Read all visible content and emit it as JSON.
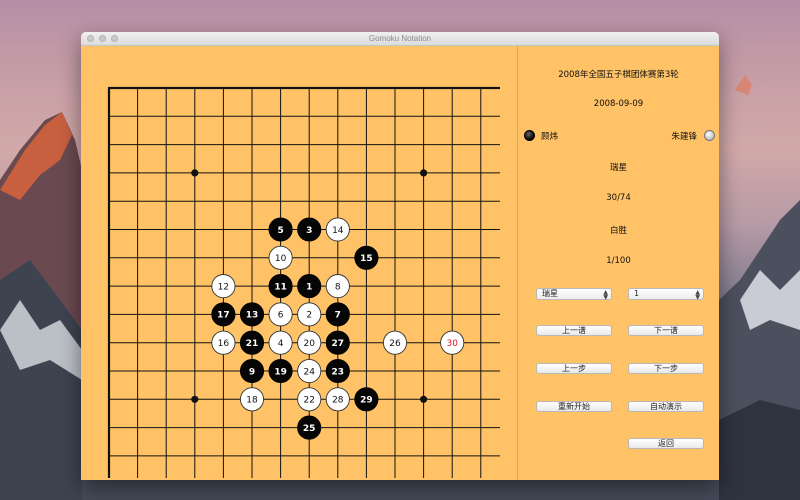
{
  "window": {
    "title": "Gomoku Notation"
  },
  "game": {
    "event": "2008年全国五子棋团体赛第3轮",
    "date": "2008-09-09",
    "black_player": "顾炜",
    "white_player": "朱建锋",
    "opening": "瑞星",
    "move_progress": "30/74",
    "result": "白胜",
    "record_index": "1/100"
  },
  "controls": {
    "opening_select": "瑞星",
    "record_select": "1",
    "prev_record": "上一谱",
    "next_record": "下一谱",
    "prev_step": "上一步",
    "next_step": "下一步",
    "restart": "重新开始",
    "autoplay": "自动演示",
    "back": "返回"
  },
  "board": {
    "size": 15,
    "star_points": [
      [
        3,
        3
      ],
      [
        11,
        3
      ],
      [
        3,
        11
      ],
      [
        11,
        11
      ]
    ],
    "last_move_color": "#e0102a",
    "stones": [
      {
        "n": 1,
        "col": 7,
        "row": 7,
        "color": "black"
      },
      {
        "n": 2,
        "col": 7,
        "row": 8,
        "color": "white"
      },
      {
        "n": 3,
        "col": 7,
        "row": 5,
        "color": "black"
      },
      {
        "n": 4,
        "col": 6,
        "row": 9,
        "color": "white"
      },
      {
        "n": 5,
        "col": 6,
        "row": 5,
        "color": "black"
      },
      {
        "n": 6,
        "col": 6,
        "row": 8,
        "color": "white"
      },
      {
        "n": 7,
        "col": 8,
        "row": 8,
        "color": "black"
      },
      {
        "n": 8,
        "col": 8,
        "row": 7,
        "color": "white"
      },
      {
        "n": 9,
        "col": 5,
        "row": 10,
        "color": "black"
      },
      {
        "n": 10,
        "col": 6,
        "row": 6,
        "color": "white"
      },
      {
        "n": 11,
        "col": 6,
        "row": 7,
        "color": "black"
      },
      {
        "n": 12,
        "col": 4,
        "row": 7,
        "color": "white"
      },
      {
        "n": 13,
        "col": 5,
        "row": 8,
        "color": "black"
      },
      {
        "n": 14,
        "col": 8,
        "row": 5,
        "color": "white"
      },
      {
        "n": 15,
        "col": 9,
        "row": 6,
        "color": "black"
      },
      {
        "n": 16,
        "col": 4,
        "row": 9,
        "color": "white"
      },
      {
        "n": 17,
        "col": 4,
        "row": 8,
        "color": "black"
      },
      {
        "n": 18,
        "col": 5,
        "row": 11,
        "color": "white"
      },
      {
        "n": 19,
        "col": 6,
        "row": 10,
        "color": "black"
      },
      {
        "n": 20,
        "col": 7,
        "row": 9,
        "color": "white"
      },
      {
        "n": 21,
        "col": 5,
        "row": 9,
        "color": "black"
      },
      {
        "n": 22,
        "col": 7,
        "row": 11,
        "color": "white"
      },
      {
        "n": 23,
        "col": 8,
        "row": 10,
        "color": "black"
      },
      {
        "n": 24,
        "col": 7,
        "row": 10,
        "color": "white"
      },
      {
        "n": 25,
        "col": 7,
        "row": 12,
        "color": "black"
      },
      {
        "n": 26,
        "col": 10,
        "row": 9,
        "color": "white"
      },
      {
        "n": 27,
        "col": 8,
        "row": 9,
        "color": "black"
      },
      {
        "n": 28,
        "col": 8,
        "row": 11,
        "color": "white"
      },
      {
        "n": 29,
        "col": 9,
        "row": 11,
        "color": "black"
      },
      {
        "n": 30,
        "col": 12,
        "row": 9,
        "color": "white"
      }
    ]
  }
}
